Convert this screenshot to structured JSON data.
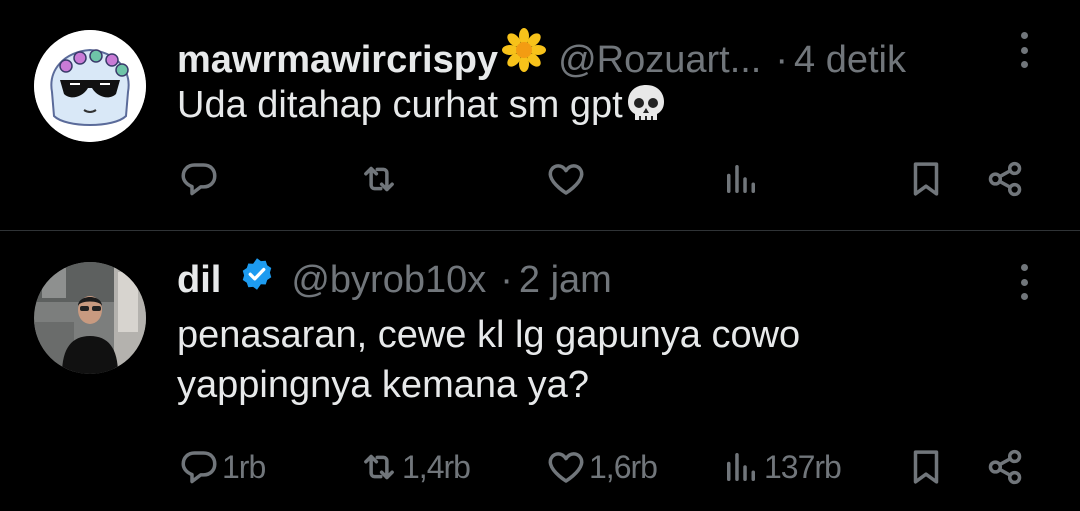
{
  "tweets": [
    {
      "display_name": "mawrmawircrispy",
      "name_emoji": "sunflower-emoji",
      "handle": "@Rozuart...",
      "separator": "·",
      "time": "4 detik",
      "text": "Uda ditahap curhat sm gpt",
      "text_emoji": "skull-emoji",
      "counts": {
        "reply": "",
        "retweet": "",
        "like": "",
        "views": ""
      }
    },
    {
      "display_name": "dil",
      "verified": true,
      "handle": "@byrob10x",
      "separator": "·",
      "time": "2 jam",
      "text_line1": "penasaran, cewe kl lg gapunya cowo",
      "text_line2": "yappingnya kemana ya?",
      "counts": {
        "reply": "1rb",
        "retweet": "1,4rb",
        "like": "1,6rb",
        "views": "137rb"
      }
    }
  ],
  "colors": {
    "background": "#000000",
    "primary_text": "#e7e9ea",
    "secondary_text": "#71767b",
    "divider": "#2f3336",
    "verified_blue": "#1d9bf0"
  }
}
